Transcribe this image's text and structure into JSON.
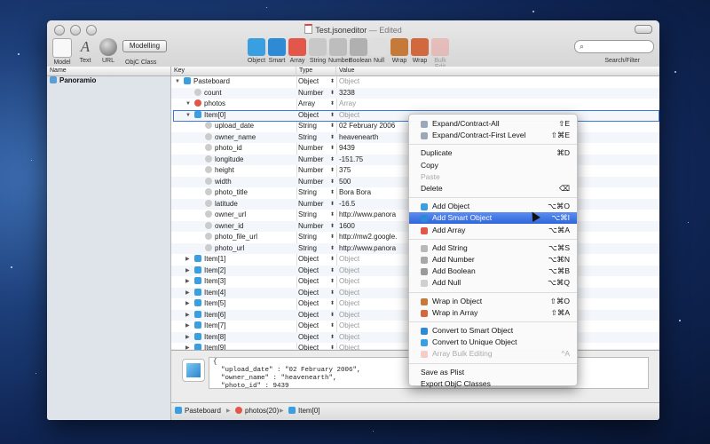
{
  "window": {
    "title": "Test.jsoneditor",
    "edited": "— Edited"
  },
  "toolbar": {
    "left": [
      {
        "label": "Model",
        "icon": "model-icon"
      },
      {
        "label": "Text",
        "icon": "text-icon"
      },
      {
        "label": "URL",
        "icon": "url-icon"
      }
    ],
    "modelling_button": "Modelling",
    "objc_class_label": "ObjC Class",
    "tools": [
      {
        "label": "Object",
        "icon": "object-icon",
        "color": "#3a9fe0",
        "disabled": false
      },
      {
        "label": "Smart",
        "icon": "smart-icon",
        "color": "#2f8ad6",
        "disabled": false
      },
      {
        "label": "Array",
        "icon": "array-icon",
        "color": "#e3574a",
        "disabled": false
      },
      {
        "label": "String",
        "icon": "string-icon",
        "color": "#c8c8c8",
        "disabled": false
      },
      {
        "label": "Number",
        "icon": "number-icon",
        "color": "#bdbdbd",
        "disabled": false
      },
      {
        "label": "Boolean",
        "icon": "boolean-icon",
        "color": "#b0b0b0",
        "disabled": false
      },
      {
        "label": "Null",
        "icon": "null-icon",
        "color": "#dedede",
        "disabled": false
      },
      {
        "label": "Wrap",
        "icon": "wrap-object-icon",
        "color": "#c57a3a",
        "disabled": false
      },
      {
        "label": "Wrap",
        "icon": "wrap-array-icon",
        "color": "#d2683d",
        "disabled": false
      },
      {
        "label": "Bulk Edit",
        "icon": "bulk-edit-icon",
        "color": "#eaa09a",
        "disabled": true
      }
    ],
    "search_label": "Search/Filter"
  },
  "sidebar": {
    "header": "Name",
    "items": [
      {
        "label": "Panoramio"
      }
    ]
  },
  "columns": {
    "key": "Key",
    "type": "Type",
    "value": "Value"
  },
  "rows": [
    {
      "indent": 0,
      "tri": "▼",
      "icon": "obj",
      "key": "Pasteboard",
      "type": "Object",
      "value": "Object",
      "gray": true
    },
    {
      "indent": 1,
      "tri": "",
      "icon": "leaf",
      "key": "count",
      "type": "Number",
      "value": "3238",
      "gray": false
    },
    {
      "indent": 1,
      "tri": "▼",
      "icon": "arr",
      "key": "photos",
      "type": "Array",
      "value": "Array",
      "gray": true
    },
    {
      "indent": 2,
      "tri": "▼",
      "icon": "obj",
      "key": "Item[0]",
      "type": "Object",
      "value": "Object",
      "gray": true
    },
    {
      "indent": 3,
      "tri": "",
      "icon": "leaf",
      "key": "upload_date",
      "type": "String",
      "value": "02 February 2006",
      "gray": false
    },
    {
      "indent": 3,
      "tri": "",
      "icon": "leaf",
      "key": "owner_name",
      "type": "String",
      "value": "heavenearth",
      "gray": false
    },
    {
      "indent": 3,
      "tri": "",
      "icon": "leaf",
      "key": "photo_id",
      "type": "Number",
      "value": "9439",
      "gray": false
    },
    {
      "indent": 3,
      "tri": "",
      "icon": "leaf",
      "key": "longitude",
      "type": "Number",
      "value": "-151.75",
      "gray": false
    },
    {
      "indent": 3,
      "tri": "",
      "icon": "leaf",
      "key": "height",
      "type": "Number",
      "value": "375",
      "gray": false
    },
    {
      "indent": 3,
      "tri": "",
      "icon": "leaf",
      "key": "width",
      "type": "Number",
      "value": "500",
      "gray": false
    },
    {
      "indent": 3,
      "tri": "",
      "icon": "leaf",
      "key": "photo_title",
      "type": "String",
      "value": "Bora Bora",
      "gray": false
    },
    {
      "indent": 3,
      "tri": "",
      "icon": "leaf",
      "key": "latitude",
      "type": "Number",
      "value": "-16.5",
      "gray": false
    },
    {
      "indent": 3,
      "tri": "",
      "icon": "leaf",
      "key": "owner_url",
      "type": "String",
      "value": "http://www.panora",
      "gray": false
    },
    {
      "indent": 3,
      "tri": "",
      "icon": "leaf",
      "key": "owner_id",
      "type": "Number",
      "value": "1600",
      "gray": false
    },
    {
      "indent": 3,
      "tri": "",
      "icon": "leaf",
      "key": "photo_file_url",
      "type": "String",
      "value": "http://mw2.google.",
      "gray": false
    },
    {
      "indent": 3,
      "tri": "",
      "icon": "leaf",
      "key": "photo_url",
      "type": "String",
      "value": "http://www.panora",
      "gray": false
    },
    {
      "indent": 2,
      "tri": "▶",
      "icon": "obj",
      "key": "Item[1]",
      "type": "Object",
      "value": "Object",
      "gray": true
    },
    {
      "indent": 2,
      "tri": "▶",
      "icon": "obj",
      "key": "Item[2]",
      "type": "Object",
      "value": "Object",
      "gray": true
    },
    {
      "indent": 2,
      "tri": "▶",
      "icon": "obj",
      "key": "Item[3]",
      "type": "Object",
      "value": "Object",
      "gray": true
    },
    {
      "indent": 2,
      "tri": "▶",
      "icon": "obj",
      "key": "Item[4]",
      "type": "Object",
      "value": "Object",
      "gray": true
    },
    {
      "indent": 2,
      "tri": "▶",
      "icon": "obj",
      "key": "Item[5]",
      "type": "Object",
      "value": "Object",
      "gray": true
    },
    {
      "indent": 2,
      "tri": "▶",
      "icon": "obj",
      "key": "Item[6]",
      "type": "Object",
      "value": "Object",
      "gray": true
    },
    {
      "indent": 2,
      "tri": "▶",
      "icon": "obj",
      "key": "Item[7]",
      "type": "Object",
      "value": "Object",
      "gray": true
    },
    {
      "indent": 2,
      "tri": "▶",
      "icon": "obj",
      "key": "Item[8]",
      "type": "Object",
      "value": "Object",
      "gray": true
    },
    {
      "indent": 2,
      "tri": "▶",
      "icon": "obj",
      "key": "Item[9]",
      "type": "Object",
      "value": "Object",
      "gray": true
    }
  ],
  "preview": {
    "lines": [
      "{",
      "  \"upload_date\" : \"02 February 2006\",",
      "  \"owner_name\" : \"heavenearth\",",
      "  \"photo_id\" : 9439"
    ]
  },
  "pathbar": [
    {
      "label": "Pasteboard",
      "icon": "obj"
    },
    {
      "label": "photos(20)",
      "icon": "arr"
    },
    {
      "label": "Item[0]",
      "icon": "obj"
    }
  ],
  "context_menu": {
    "items": [
      {
        "type": "item",
        "label": "Expand/Contract-All",
        "shortcut": "⇧E",
        "icon": "expand-icon",
        "disabled": false,
        "highlighted": false
      },
      {
        "type": "item",
        "label": "Expand/Contract-First Level",
        "shortcut": "⇧⌘E",
        "icon": "expand-icon",
        "disabled": false,
        "highlighted": false
      },
      {
        "type": "sep"
      },
      {
        "type": "item",
        "label": "Duplicate",
        "shortcut": "⌘D",
        "icon": "",
        "disabled": false,
        "highlighted": false
      },
      {
        "type": "item",
        "label": "Copy",
        "shortcut": "",
        "icon": "",
        "disabled": false,
        "highlighted": false
      },
      {
        "type": "item",
        "label": "Paste",
        "shortcut": "",
        "icon": "",
        "disabled": true,
        "highlighted": false
      },
      {
        "type": "item",
        "label": "Delete",
        "shortcut": "⌫",
        "icon": "",
        "disabled": false,
        "highlighted": false
      },
      {
        "type": "sep"
      },
      {
        "type": "item",
        "label": "Add Object",
        "shortcut": "⌥⌘O",
        "icon": "object-icon",
        "disabled": false,
        "highlighted": false
      },
      {
        "type": "item",
        "label": "Add Smart Object",
        "shortcut": "⌥⌘I",
        "icon": "smart-icon",
        "disabled": false,
        "highlighted": true
      },
      {
        "type": "item",
        "label": "Add Array",
        "shortcut": "⌥⌘A",
        "icon": "array-icon",
        "disabled": false,
        "highlighted": false
      },
      {
        "type": "sep"
      },
      {
        "type": "item",
        "label": "Add String",
        "shortcut": "⌥⌘S",
        "icon": "string-icon",
        "disabled": false,
        "highlighted": false
      },
      {
        "type": "item",
        "label": "Add Number",
        "shortcut": "⌥⌘N",
        "icon": "number-icon",
        "disabled": false,
        "highlighted": false
      },
      {
        "type": "item",
        "label": "Add Boolean",
        "shortcut": "⌥⌘B",
        "icon": "boolean-icon",
        "disabled": false,
        "highlighted": false
      },
      {
        "type": "item",
        "label": "Add Null",
        "shortcut": "⌥⌘Q",
        "icon": "null-icon",
        "disabled": false,
        "highlighted": false
      },
      {
        "type": "sep"
      },
      {
        "type": "item",
        "label": "Wrap in Object",
        "shortcut": "⇧⌘O",
        "icon": "wrap-object-icon",
        "disabled": false,
        "highlighted": false
      },
      {
        "type": "item",
        "label": "Wrap in Array",
        "shortcut": "⇧⌘A",
        "icon": "wrap-array-icon",
        "disabled": false,
        "highlighted": false
      },
      {
        "type": "sep"
      },
      {
        "type": "item",
        "label": "Convert to Smart Object",
        "shortcut": "",
        "icon": "smart-icon",
        "disabled": false,
        "highlighted": false
      },
      {
        "type": "item",
        "label": "Convert to Unique Object",
        "shortcut": "",
        "icon": "object-icon",
        "disabled": false,
        "highlighted": false
      },
      {
        "type": "item",
        "label": "Array Bulk Editing",
        "shortcut": "^A",
        "icon": "bulk-edit-icon",
        "disabled": true,
        "highlighted": false
      },
      {
        "type": "sep"
      },
      {
        "type": "item",
        "label": "Save as Plist",
        "shortcut": "",
        "icon": "",
        "disabled": false,
        "highlighted": false
      },
      {
        "type": "item",
        "label": "Export ObjC Classes",
        "shortcut": "",
        "icon": "",
        "disabled": false,
        "highlighted": false
      }
    ]
  },
  "colors": {
    "selection": "#2f66da",
    "object": "#3a9fe0",
    "array": "#e3574a"
  }
}
